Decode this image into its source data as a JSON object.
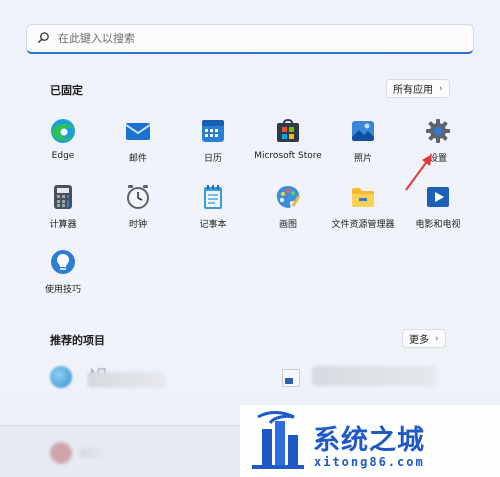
{
  "search": {
    "placeholder": "在此键入以搜索"
  },
  "pinned": {
    "title": "已固定",
    "all_apps_label": "所有应用",
    "apps": [
      {
        "label": "Edge"
      },
      {
        "label": "邮件"
      },
      {
        "label": "日历"
      },
      {
        "label": "Microsoft Store"
      },
      {
        "label": "照片"
      },
      {
        "label": "设置"
      },
      {
        "label": "计算器"
      },
      {
        "label": "时钟"
      },
      {
        "label": "记事本"
      },
      {
        "label": "画图"
      },
      {
        "label": "文件资源管理器"
      },
      {
        "label": "电影和电视"
      },
      {
        "label": "使用技巧"
      }
    ]
  },
  "recommended": {
    "title": "推荐的项目",
    "more_label": "更多",
    "item_left_text": "入门"
  },
  "watermark": {
    "name": "系统之城",
    "url": "xitong86.com"
  },
  "colors": {
    "accent": "#2f6fd6",
    "arrow": "#e53935",
    "brand": "#1f58c7"
  }
}
